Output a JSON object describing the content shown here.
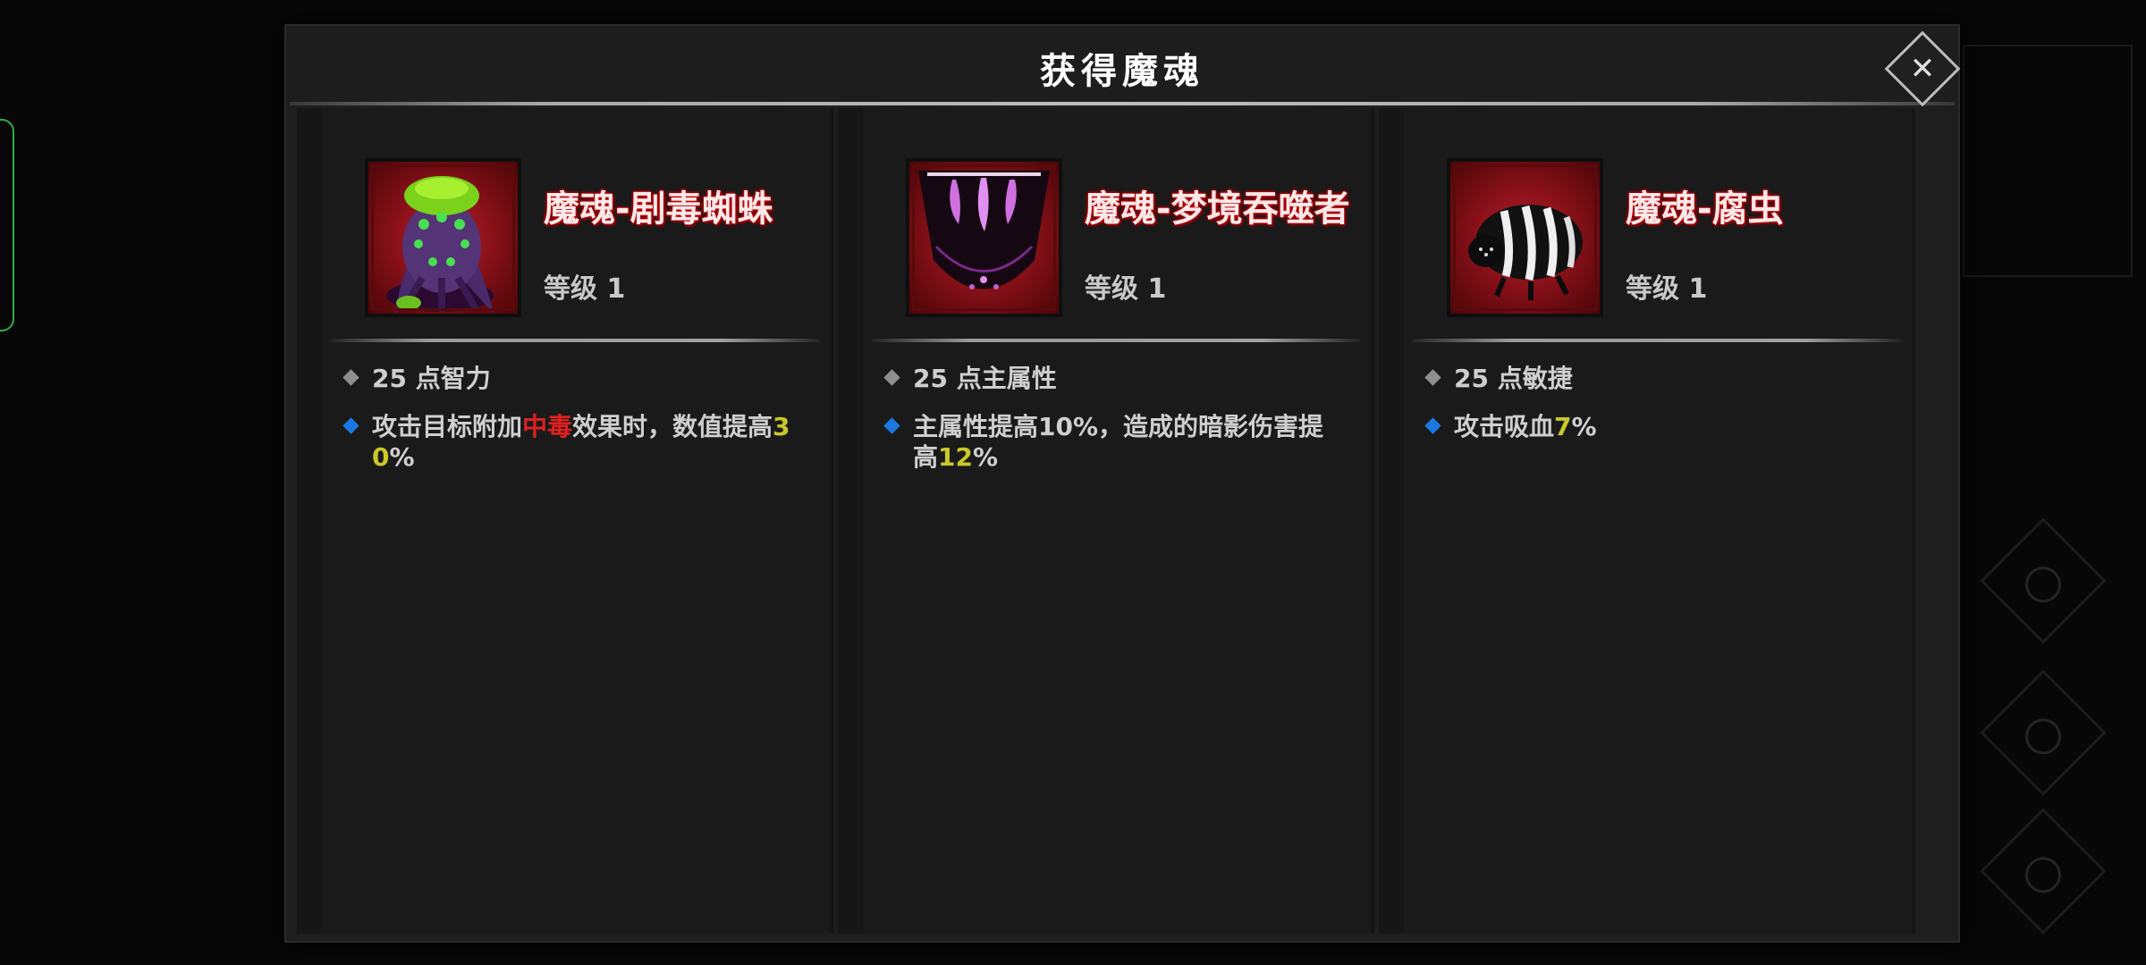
{
  "modal": {
    "title": "获得魔魂",
    "close_label": "✕"
  },
  "cards": [
    {
      "name": "魔魂-剧毒蜘蛛",
      "level": "等级 1",
      "attr1": "25 点智力",
      "effect_prefix": "攻击目标附加",
      "effect_highlight": "中毒",
      "effect_mid": "效果时，数值提高",
      "effect_num_a": "3",
      "effect_num_b": "0",
      "effect_suffix": "%"
    },
    {
      "name": "魔魂-梦境吞噬者",
      "level": "等级 1",
      "attr1": "25 点主属性",
      "effect_line1": "主属性提高10%，造成的暗影伤害提",
      "effect_line2_prefix": "高",
      "effect_num": "12",
      "effect_suffix": "%"
    },
    {
      "name": "魔魂-腐虫",
      "level": "等级 1",
      "attr1": "25 点敏捷",
      "effect_prefix": "攻击吸血",
      "effect_num": "7",
      "effect_suffix": "%"
    }
  ],
  "colors": {
    "highlight_red": "#e02020",
    "highlight_yellow": "#c9c82a",
    "bullet_blue": "#1a78e0",
    "bullet_gray": "#8e8e8e"
  },
  "icons": [
    "spider-portrait",
    "dream-devourer-portrait",
    "rot-worm-portrait",
    "close-icon"
  ]
}
